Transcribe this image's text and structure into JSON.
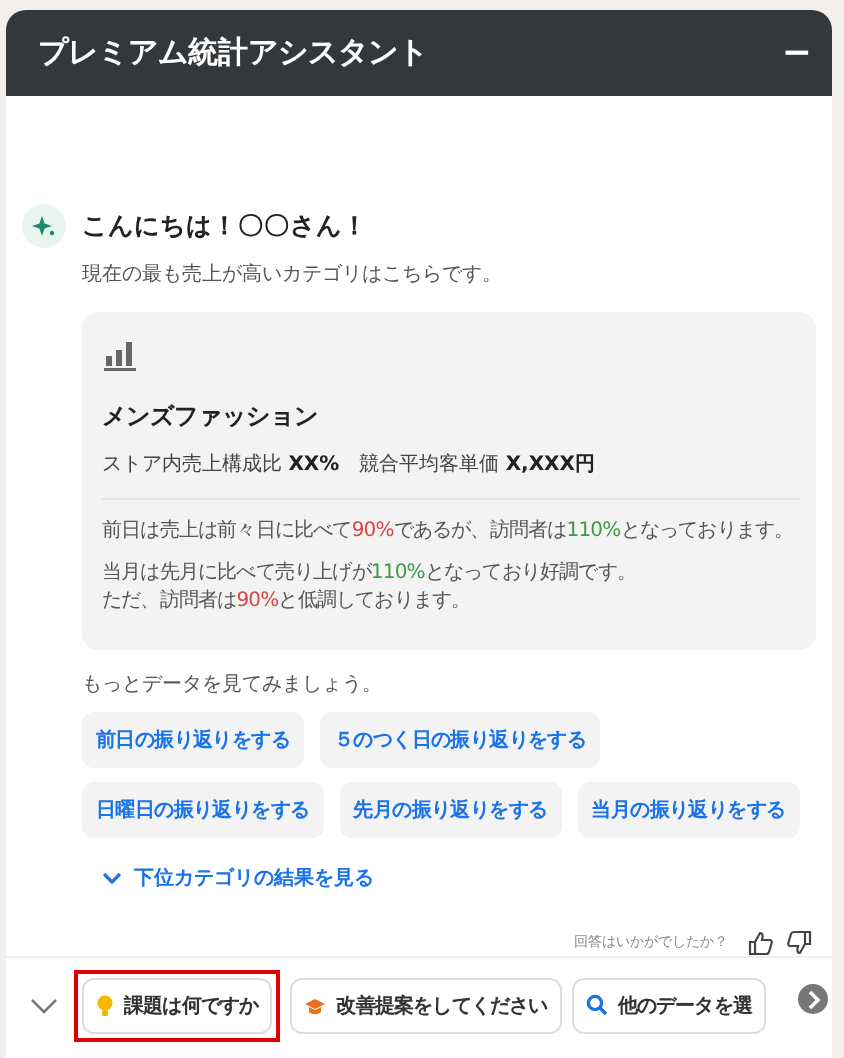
{
  "window": {
    "title": "プレミアム統計アシスタント",
    "minimize": "−"
  },
  "message": {
    "greeting": "こんにちは！〇〇さん！",
    "intro": "現在の最も売上が高いカテゴリはこちらです。",
    "card": {
      "title": "メンズファッション",
      "stats": "ストア内売上構成比 **XX%**　競合平均客単価 **X,XXX円**",
      "paragraphs": [
        [
          {
            "kind": "plain",
            "text": "前日は売上は前々日に比べて"
          },
          {
            "kind": "down",
            "text": "90%"
          },
          {
            "kind": "plain",
            "text": "であるが、訪問者は"
          },
          {
            "kind": "up",
            "text": "110%"
          },
          {
            "kind": "plain",
            "text": "となっております。"
          }
        ],
        [
          {
            "kind": "plain",
            "text": "当月は先月に比べて売り上げが"
          },
          {
            "kind": "up",
            "text": "110%"
          },
          {
            "kind": "plain",
            "text": "となっており好調です。"
          },
          {
            "kind": "break"
          },
          {
            "kind": "plain",
            "text": "ただ、訪問者は"
          },
          {
            "kind": "down",
            "text": "90%"
          },
          {
            "kind": "plain",
            "text": "と低調しております。"
          }
        ]
      ]
    },
    "prompt": "もっとデータを見てみましょう。",
    "actions": [
      [
        "前日の振り返りをする",
        "５のつく日の振り返りをする"
      ],
      [
        "日曜日の振り返りをする",
        "先月の振り返りをする",
        "当月の振り返りをする"
      ]
    ],
    "more_link": "下位カテゴリの結果を見る",
    "feedback": "回答はいかがでしたか？"
  },
  "suggestions": [
    {
      "label": "課題は何ですか",
      "highlighted": true
    },
    {
      "label": "改善提案をしてください",
      "highlighted": false
    },
    {
      "label": "他のデータを選",
      "highlighted": false
    }
  ]
}
